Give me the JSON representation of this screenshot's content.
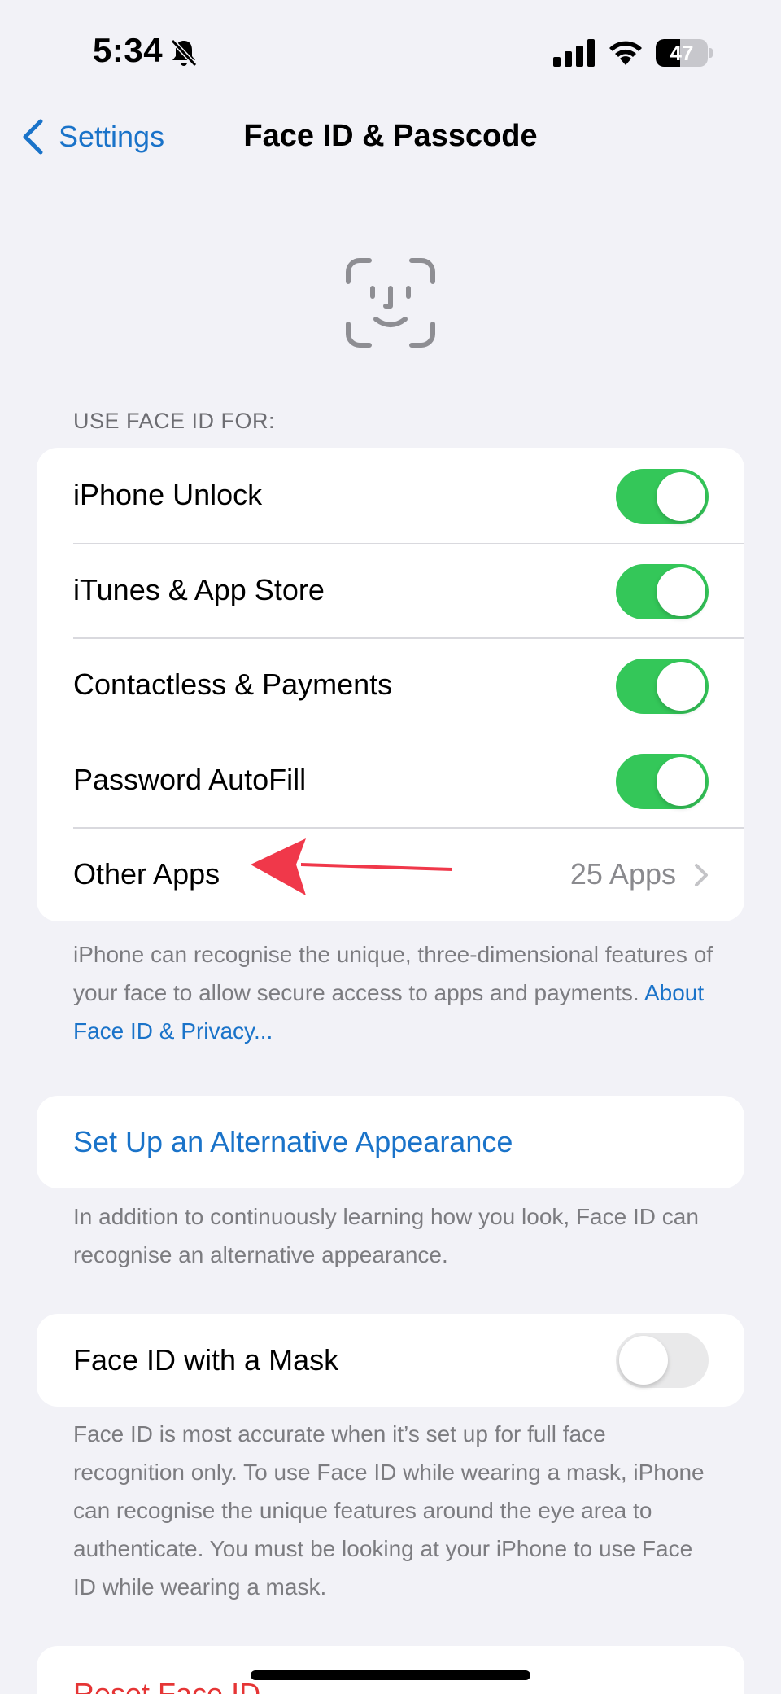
{
  "status_bar": {
    "time": "5:34",
    "battery_level": "47",
    "battery_fraction": 0.47,
    "icons": [
      "bell-slash-icon",
      "cellular-signal-icon",
      "wifi-icon",
      "battery-icon"
    ]
  },
  "nav": {
    "back_label": "Settings",
    "title": "Face ID & Passcode"
  },
  "face_id_section": {
    "header": "USE FACE ID FOR:",
    "rows": [
      {
        "label": "iPhone Unlock",
        "toggle": true
      },
      {
        "label": "iTunes & App Store",
        "toggle": true
      },
      {
        "label": "Contactless & Payments",
        "toggle": true
      },
      {
        "label": "Password AutoFill",
        "toggle": true
      },
      {
        "label": "Other Apps",
        "value": "25 Apps"
      }
    ],
    "footer": "iPhone can recognise the unique, three-dimensional features of your face to allow secure access to apps and payments.",
    "footer_link": "About Face ID & Privacy..."
  },
  "alternative_section": {
    "label": "Set Up an Alternative Appearance",
    "footer": "In addition to continuously learning how you look, Face ID can recognise an alternative appearance."
  },
  "mask_section": {
    "label": "Face ID with a Mask",
    "toggle": false,
    "footer": "Face ID is most accurate when it’s set up for full face recognition only. To use Face ID while wearing a mask, iPhone can recognise the unique features around the eye area to authenticate. You must be looking at your iPhone to use Face ID while wearing a mask."
  },
  "reset_section": {
    "label": "Reset Face ID"
  },
  "colors": {
    "accent": "#1a73c9",
    "toggle_on": "#34c759",
    "toggle_off": "#e9e9ea",
    "destructive": "#e53535",
    "annotation_arrow": "#f0384a",
    "background": "#f2f2f7"
  }
}
